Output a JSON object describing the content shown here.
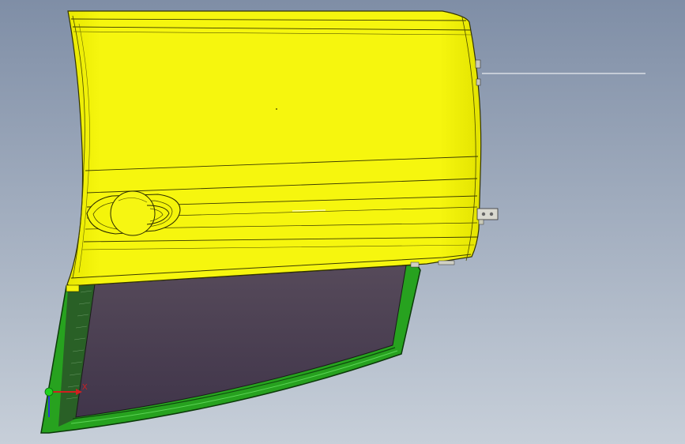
{
  "viewport": {
    "background_top": "#7f8ea6",
    "background_bottom": "#c7cfd9"
  },
  "model": {
    "door_color": "#f4f40a",
    "door_outline": "#2d2d00",
    "frame_color": "#25a020",
    "glass_color": "#4a3c4c"
  },
  "triad": {
    "x_label": "X",
    "x_color": "#d21f1f",
    "y_color": "#1fd21f",
    "z_color": "#2a3ad2"
  }
}
